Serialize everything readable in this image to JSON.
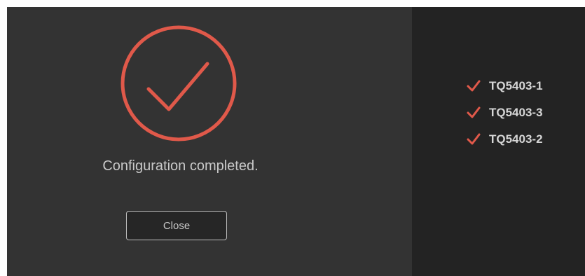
{
  "dialog": {
    "status_message": "Configuration completed.",
    "close_label": "Close",
    "accent_color": "#e0594a",
    "icons": {
      "success": "check-circle-icon",
      "item": "checkmark-icon"
    }
  },
  "devices": [
    {
      "name": "TQ5403-1",
      "status": "done"
    },
    {
      "name": "TQ5403-3",
      "status": "done"
    },
    {
      "name": "TQ5403-2",
      "status": "done"
    }
  ]
}
